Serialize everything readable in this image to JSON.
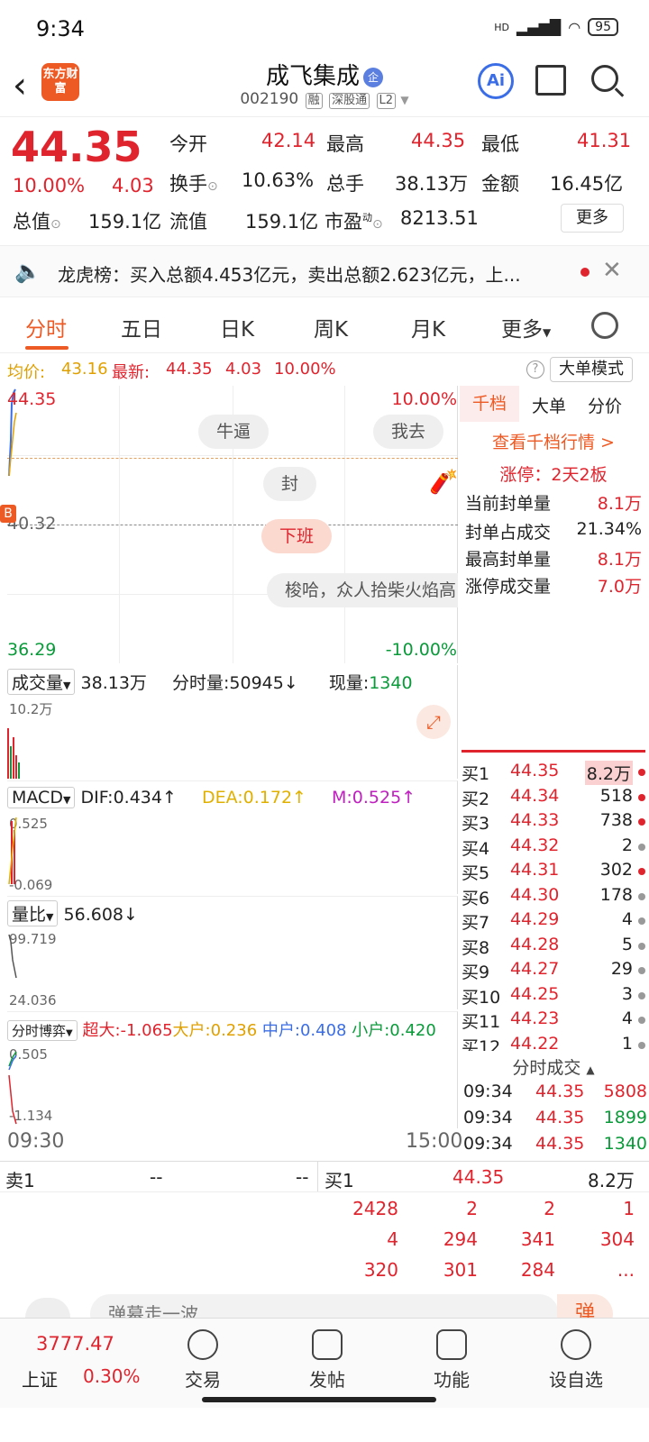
{
  "status": {
    "time": "9:34",
    "signal": "HD",
    "battery": "95"
  },
  "header": {
    "logo": "东方财富",
    "name": "成飞集成",
    "badge": "企",
    "code": "002190",
    "tags": [
      "融",
      "深股通",
      "L2"
    ],
    "ai_label": "Ai"
  },
  "quote": {
    "price": "44.35",
    "pct": "10.00%",
    "chg": "4.03",
    "open_label": "今开",
    "open": "42.14",
    "high_label": "最高",
    "high": "44.35",
    "low_label": "最低",
    "low": "41.31",
    "turnover_label": "换手",
    "turnover": "10.63%",
    "volume_label": "总手",
    "volume": "38.13万",
    "amount_label": "金额",
    "amount": "16.45亿",
    "mktcap_label": "总值",
    "mktcap": "159.1亿",
    "float_label": "流值",
    "float": "159.1亿",
    "pe_label": "市盈",
    "pe_sup": "动",
    "pe": "8213.51",
    "more": "更多"
  },
  "notice": {
    "text": "龙虎榜：买入总额4.453亿元，卖出总额2.623亿元，上..."
  },
  "tabs": [
    "分时",
    "五日",
    "日K",
    "周K",
    "月K",
    "更多"
  ],
  "avgline": {
    "avg_label": "均价:",
    "avg": "43.16",
    "latest_label": "最新:",
    "latest": "44.35",
    "chg": "4.03",
    "pct": "10.00%",
    "big_order": "大单模式"
  },
  "chart": {
    "top_price": "44.35",
    "top_pct": "10.00%",
    "mid_price": "40.32",
    "bottom_price": "36.29",
    "bottom_pct": "-10.00%",
    "bubbles": [
      "牛逼",
      "我去",
      "封",
      "下班",
      "梭哈，众人拾柴火焰高"
    ],
    "b_marker": "B",
    "start_time": "09:30",
    "end_time": "15:00"
  },
  "volume_panel": {
    "label": "成交量",
    "value": "38.13万",
    "fs_label": "分时量:",
    "fs": "50945↓",
    "now_label": "现量:",
    "now": "1340",
    "scale": "10.2万"
  },
  "macd_panel": {
    "label": "MACD",
    "dif": "DIF:0.434↑",
    "dea": "DEA:0.172↑",
    "m": "M:0.525↑",
    "top": "0.525",
    "bottom": "-0.069"
  },
  "lb_panel": {
    "label": "量比",
    "value": "56.608↓",
    "top": "99.719",
    "bottom": "24.036"
  },
  "game_panel": {
    "label": "分时博弈",
    "sd": "超大:-1.065",
    "dh": "大户:0.236",
    "zh": "中户:0.408",
    "xh": "小户:0.420",
    "top": "0.505",
    "bottom": "-1.134"
  },
  "right_panel": {
    "tabs": [
      "千档",
      "大单",
      "分价"
    ],
    "view_link": "查看千档行情 >",
    "limit_title": "涨停：2天2板",
    "rows": [
      {
        "label": "当前封单量",
        "value": "8.1万"
      },
      {
        "label": "封单占成交",
        "value": "21.34%"
      },
      {
        "label": "最高封单量",
        "value": "8.1万"
      },
      {
        "label": "涨停成交量",
        "value": "7.0万"
      }
    ],
    "orderbook": [
      {
        "label": "买1",
        "price": "44.35",
        "qty": "8.2万",
        "dot": "#e0242e"
      },
      {
        "label": "买2",
        "price": "44.34",
        "qty": "518",
        "dot": "#e0242e"
      },
      {
        "label": "买3",
        "price": "44.33",
        "qty": "738",
        "dot": "#e0242e"
      },
      {
        "label": "买4",
        "price": "44.32",
        "qty": "2",
        "dot": "#999999"
      },
      {
        "label": "买5",
        "price": "44.31",
        "qty": "302",
        "dot": "#e0242e"
      },
      {
        "label": "买6",
        "price": "44.30",
        "qty": "178",
        "dot": "#999999"
      },
      {
        "label": "买7",
        "price": "44.29",
        "qty": "4",
        "dot": "#999999"
      },
      {
        "label": "买8",
        "price": "44.28",
        "qty": "5",
        "dot": "#999999"
      },
      {
        "label": "买9",
        "price": "44.27",
        "qty": "29",
        "dot": "#999999"
      },
      {
        "label": "买10",
        "price": "44.25",
        "qty": "3",
        "dot": "#999999"
      },
      {
        "label": "买11",
        "price": "44.23",
        "qty": "4",
        "dot": "#999999"
      },
      {
        "label": "买12",
        "price": "44.22",
        "qty": "1",
        "dot": "#999999"
      }
    ],
    "trades_title": "分时成交",
    "trades": [
      {
        "time": "09:34",
        "price": "44.35",
        "qty": "5808"
      },
      {
        "time": "09:34",
        "price": "44.35",
        "qty": "1899"
      },
      {
        "time": "09:34",
        "price": "44.35",
        "qty": "1340"
      }
    ]
  },
  "bottom_table": {
    "sell_label": "卖1",
    "sell_price": "--",
    "sell_qty": "--",
    "buy_label": "买1",
    "buy_price": "44.35",
    "buy_qty": "8.2万",
    "rows": [
      [
        "2428",
        "2",
        "2",
        "1"
      ],
      [
        "4",
        "294",
        "341",
        "304"
      ],
      [
        "320",
        "301",
        "284",
        "..."
      ]
    ]
  },
  "comment": {
    "placeholder": "弹幕走一波",
    "btn": "弹"
  },
  "bottom_nav": {
    "index_value": "3777.47",
    "index_name": "上证",
    "index_pct": "0.30%",
    "items": [
      "交易",
      "发帖",
      "功能",
      "设自选"
    ]
  }
}
